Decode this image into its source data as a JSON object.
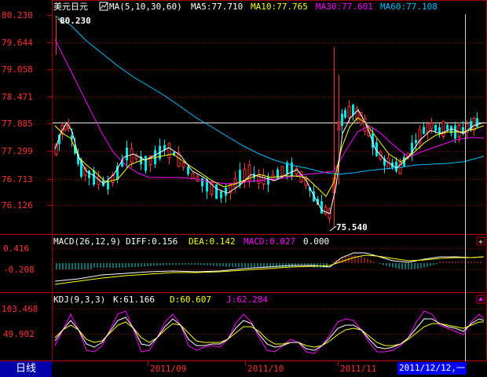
{
  "header": {
    "symbol": "美元日元",
    "ma_label": "MA(5,10,30,60)",
    "ma5": "MA5:77.710",
    "ma10": "MA10:77.765",
    "ma30": "MA30:77.601",
    "ma60": "MA60:77.108"
  },
  "macd_header": {
    "name": "MACD(26,12,9)",
    "diff": "DIFF:0.156",
    "dea": "DEA:0.142",
    "macd": "MACD:0.027",
    "extra": "0.000"
  },
  "kdj_header": {
    "name": "KDJ(9,3,3)",
    "k": "K:61.166",
    "d": "D:60.607",
    "j": "J:62.284"
  },
  "price_axis": [
    "80.230",
    "79.644",
    "79.058",
    "78.471",
    "77.885",
    "77.299",
    "76.713",
    "76.126"
  ],
  "macd_axis": [
    "0.416",
    "-0.208"
  ],
  "kdj_axis": [
    "103.468",
    "49.902"
  ],
  "annotations": {
    "high": "80.230",
    "low": "75.540"
  },
  "date_axis": [
    "2011/09",
    "2011/10",
    "2011/11"
  ],
  "status": {
    "period_tab": "日线",
    "cursor_date": "2011/12/12,一"
  },
  "icons": {
    "ma_icon": "chart-square-icon",
    "expand_macd": "plus-icon",
    "expand_kdj": "up-arrow-icon"
  },
  "colors": {
    "up": "#ff3232",
    "down": "#00e5e5",
    "ma5": "#ffffff",
    "ma10": "#ffff00",
    "ma30": "#ff00ff",
    "ma60": "#00c0ff",
    "grid": "#8a0000",
    "axis_text": "#ff3030"
  },
  "chart_data": {
    "type": "candlestick",
    "price_range": [
      75.54,
      80.23
    ],
    "high": 80.23,
    "low": 75.54,
    "ma5_last": 77.71,
    "ma10_last": 77.765,
    "ma30_last": 77.601,
    "ma60_last": 77.108
  }
}
